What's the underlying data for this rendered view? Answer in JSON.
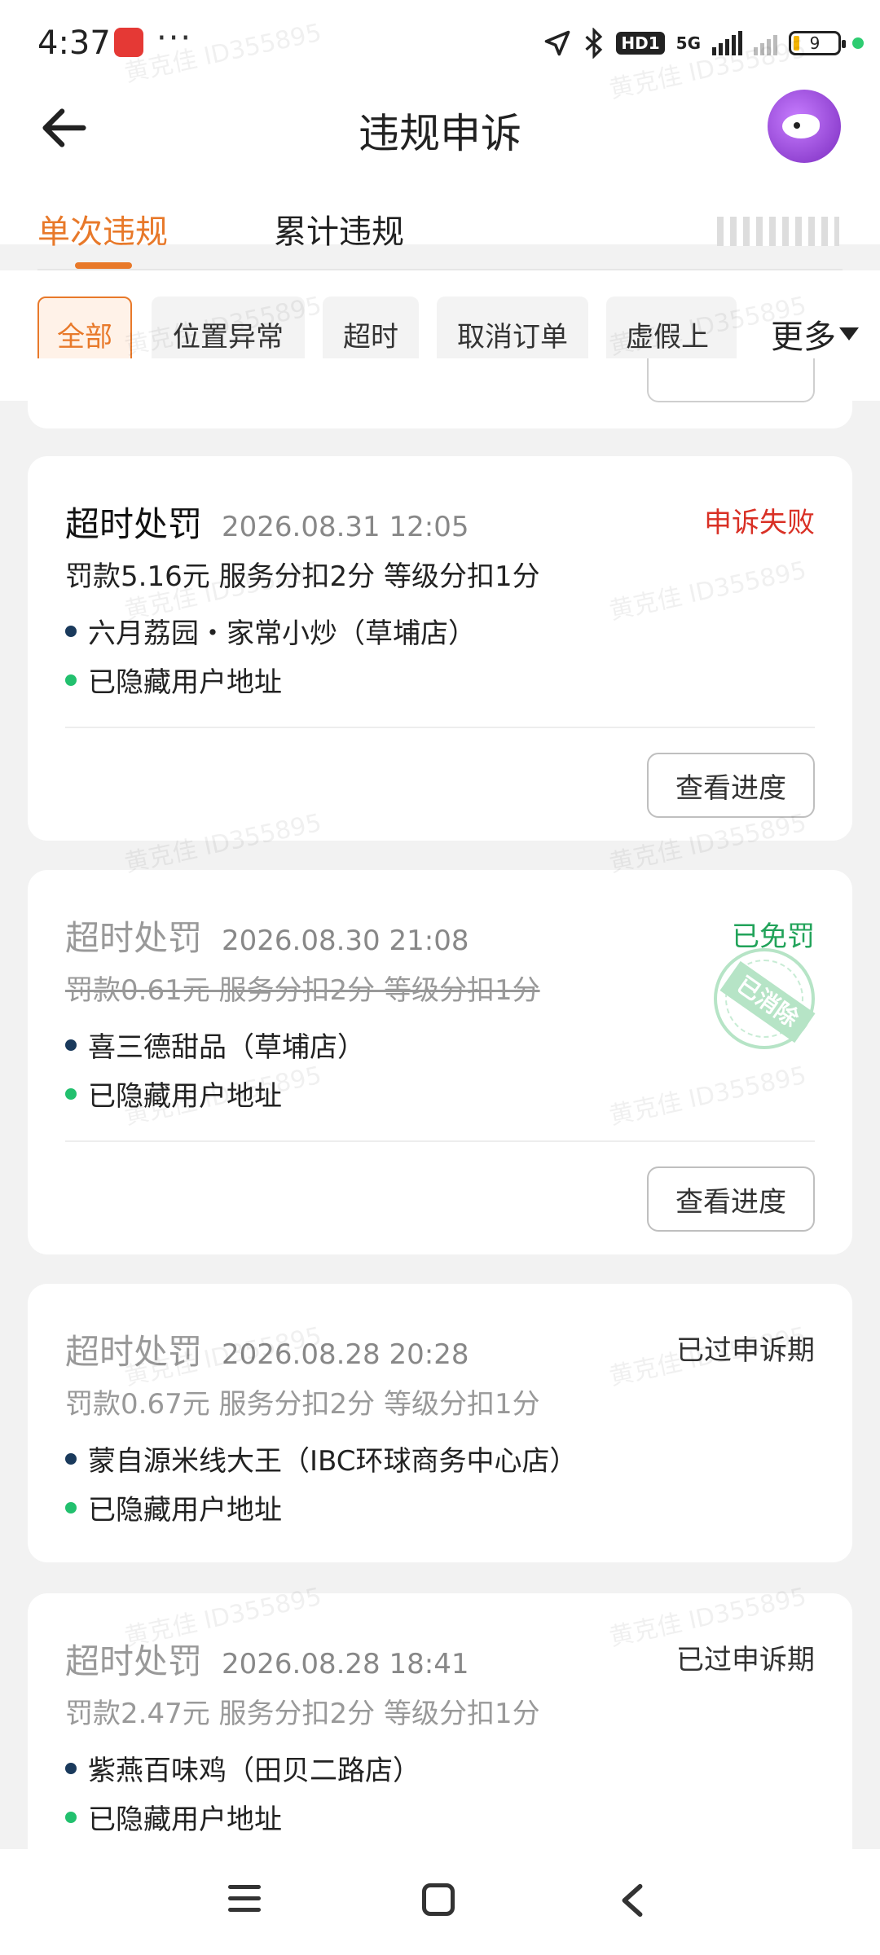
{
  "status_bar": {
    "time": "4:37",
    "more": "···",
    "hd": "HD1",
    "net": "5G",
    "battery": "9"
  },
  "header": {
    "title": "违规申诉"
  },
  "tabs": [
    {
      "label": "单次违规",
      "active": true
    },
    {
      "label": "累计违规",
      "active": false
    }
  ],
  "filters": {
    "chips": [
      {
        "label": "全部",
        "active": true
      },
      {
        "label": "位置异常",
        "active": false
      },
      {
        "label": "超时",
        "active": false
      },
      {
        "label": "取消订单",
        "active": false
      },
      {
        "label": "虚假上",
        "active": false
      }
    ],
    "more_label": "更多"
  },
  "records": [
    {
      "type": "超时处罚",
      "time": "2026.08.31 12:05",
      "status": "申诉失败",
      "status_color": "#d93025",
      "fine": "罚款5.16元 服务分扣2分 等级分扣1分",
      "shop": "六月荔园・家常小炒（草埔店）",
      "address": "已隐藏用户地址",
      "button": "查看进度"
    },
    {
      "type": "超时处罚",
      "time": "2026.08.30 21:08",
      "status": "已免罚",
      "status_color": "#22a35a",
      "fine": "罚款0.61元 服务分扣2分 等级分扣1分",
      "shop": "喜三德甜品（草埔店）",
      "address": "已隐藏用户地址",
      "button": "查看进度",
      "stamp": "已消除"
    },
    {
      "type": "超时处罚",
      "time": "2026.08.28 20:28",
      "status": "已过申诉期",
      "status_color": "#333333",
      "fine": "罚款0.67元 服务分扣2分 等级分扣1分",
      "shop": "蒙自源米线大王（IBC环球商务中心店）",
      "address": "已隐藏用户地址"
    },
    {
      "type": "超时处罚",
      "time": "2026.08.28 18:41",
      "status": "已过申诉期",
      "status_color": "#333333",
      "fine": "罚款2.47元 服务分扣2分 等级分扣1分",
      "shop": "紫燕百味鸡（田贝二路店）",
      "address": "已隐藏用户地址"
    }
  ],
  "watermark": "黄克佳 ID355895",
  "colors": {
    "accent": "#e8792a",
    "fail": "#d93025",
    "success": "#22a35a"
  }
}
